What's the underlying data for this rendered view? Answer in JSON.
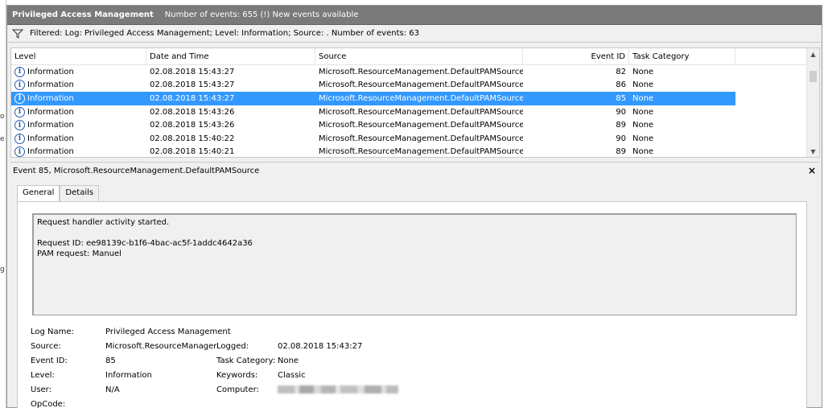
{
  "title": "Privileged Access Management",
  "event_count": "Number of events: 655 (!) New events available",
  "filter_text": "Filtered: Log: Privileged Access Management; Level: Information; Source: . Number of events: 63",
  "columns": {
    "level": "Level",
    "date": "Date and Time",
    "source": "Source",
    "id": "Event ID",
    "category": "Task Category"
  },
  "rows": [
    {
      "level": "Information",
      "date": "02.08.2018 15:43:27",
      "source": "Microsoft.ResourceManagement.DefaultPAMSource",
      "id": "82",
      "category": "None"
    },
    {
      "level": "Information",
      "date": "02.08.2018 15:43:27",
      "source": "Microsoft.ResourceManagement.DefaultPAMSource",
      "id": "86",
      "category": "None"
    },
    {
      "level": "Information",
      "date": "02.08.2018 15:43:27",
      "source": "Microsoft.ResourceManagement.DefaultPAMSource",
      "id": "85",
      "category": "None"
    },
    {
      "level": "Information",
      "date": "02.08.2018 15:43:26",
      "source": "Microsoft.ResourceManagement.DefaultPAMSource",
      "id": "90",
      "category": "None"
    },
    {
      "level": "Information",
      "date": "02.08.2018 15:43:26",
      "source": "Microsoft.ResourceManagement.DefaultPAMSource",
      "id": "89",
      "category": "None"
    },
    {
      "level": "Information",
      "date": "02.08.2018 15:40:22",
      "source": "Microsoft.ResourceManagement.DefaultPAMSource",
      "id": "90",
      "category": "None"
    },
    {
      "level": "Information",
      "date": "02.08.2018 15:40:21",
      "source": "Microsoft.ResourceManagement.DefaultPAMSource",
      "id": "89",
      "category": "None"
    }
  ],
  "selected_row_index": 2,
  "detail": {
    "header": "Event 85, Microsoft.ResourceManagement.DefaultPAMSource",
    "close_label": "×",
    "tabs": [
      "General",
      "Details"
    ],
    "description": {
      "line1": "Request handler activity started.",
      "line2": "Request ID: ee98139c-b1f6-4bac-ac5f-1addc4642a36",
      "line3": "PAM request: Manuel"
    },
    "props": {
      "log_name_label": "Log Name:",
      "log_name_value": "Privileged Access Management",
      "source_label": "Source:",
      "source_value": "Microsoft.ResourceManager",
      "logged_label": "Logged:",
      "logged_value": "02.08.2018 15:43:27",
      "event_id_label": "Event ID:",
      "event_id_value": "85",
      "task_category_label": "Task Category:",
      "task_category_value": "None",
      "level_label": "Level:",
      "level_value": "Information",
      "keywords_label": "Keywords:",
      "keywords_value": "Classic",
      "user_label": "User:",
      "user_value": "N/A",
      "computer_label": "Computer:",
      "opcode_label": "OpCode:"
    }
  },
  "colors": {
    "selection": "#3399ff",
    "titlebar": "#7a7a7a",
    "info_icon": "#2a5ea8"
  }
}
